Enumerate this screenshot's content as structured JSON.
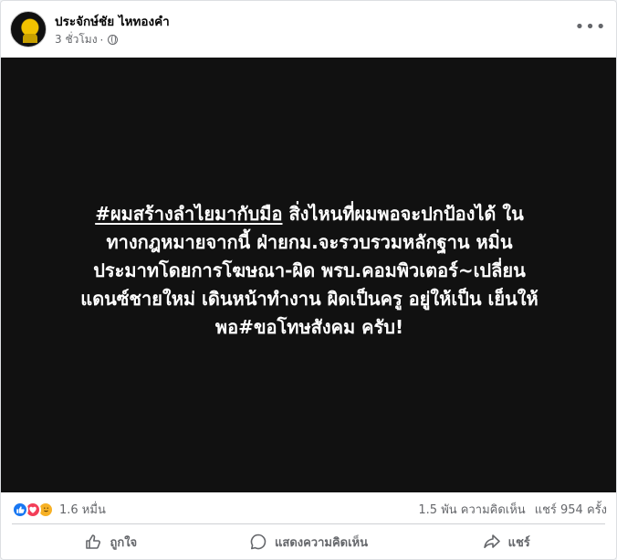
{
  "post": {
    "author": "ประจักษ์ชัย ไหทองคำ",
    "time": "3 ชั่วโมง",
    "separator": "·",
    "more_icon": "more-horizontal-icon",
    "privacy_icon": "globe-icon"
  },
  "media": {
    "hashtag": "#ผมสร้างลำไยมากับมือ",
    "text_line1_rest": " สิ่งไหนที่ผมพอจะปกป้องได้ ใน",
    "text_line2": "ทางกฎหมายจากนี้ ฝ่ายกม.จะรวบรวมหลักฐาน หมิ่น",
    "text_line3": "ประมาทโดยการโฆษณา-ผิด พรบ.คอมพิวเตอร์~เปลี่ยน",
    "text_line4": "แดนซ์ชายใหม่ เดินหน้าทำงาน ผิดเป็นครู อยู่ให้เป็น เย็นให้",
    "text_line5": "พอ#ขอโทษสังคม ครับ!",
    "background": "#111111"
  },
  "stats": {
    "reaction_count": "1.6 หมื่น",
    "comments": "1.5 พัน ความคิดเห็น",
    "shares": "แชร์ 954 ครั้ง"
  },
  "actions": {
    "like": "ถูกใจ",
    "comment": "แสดงความคิดเห็น",
    "share": "แชร์"
  },
  "colors": {
    "like_blue": "#1877f2",
    "love_red": "#f33e58",
    "wow_yellow": "#f7b125",
    "secondary_text": "#65676b"
  }
}
